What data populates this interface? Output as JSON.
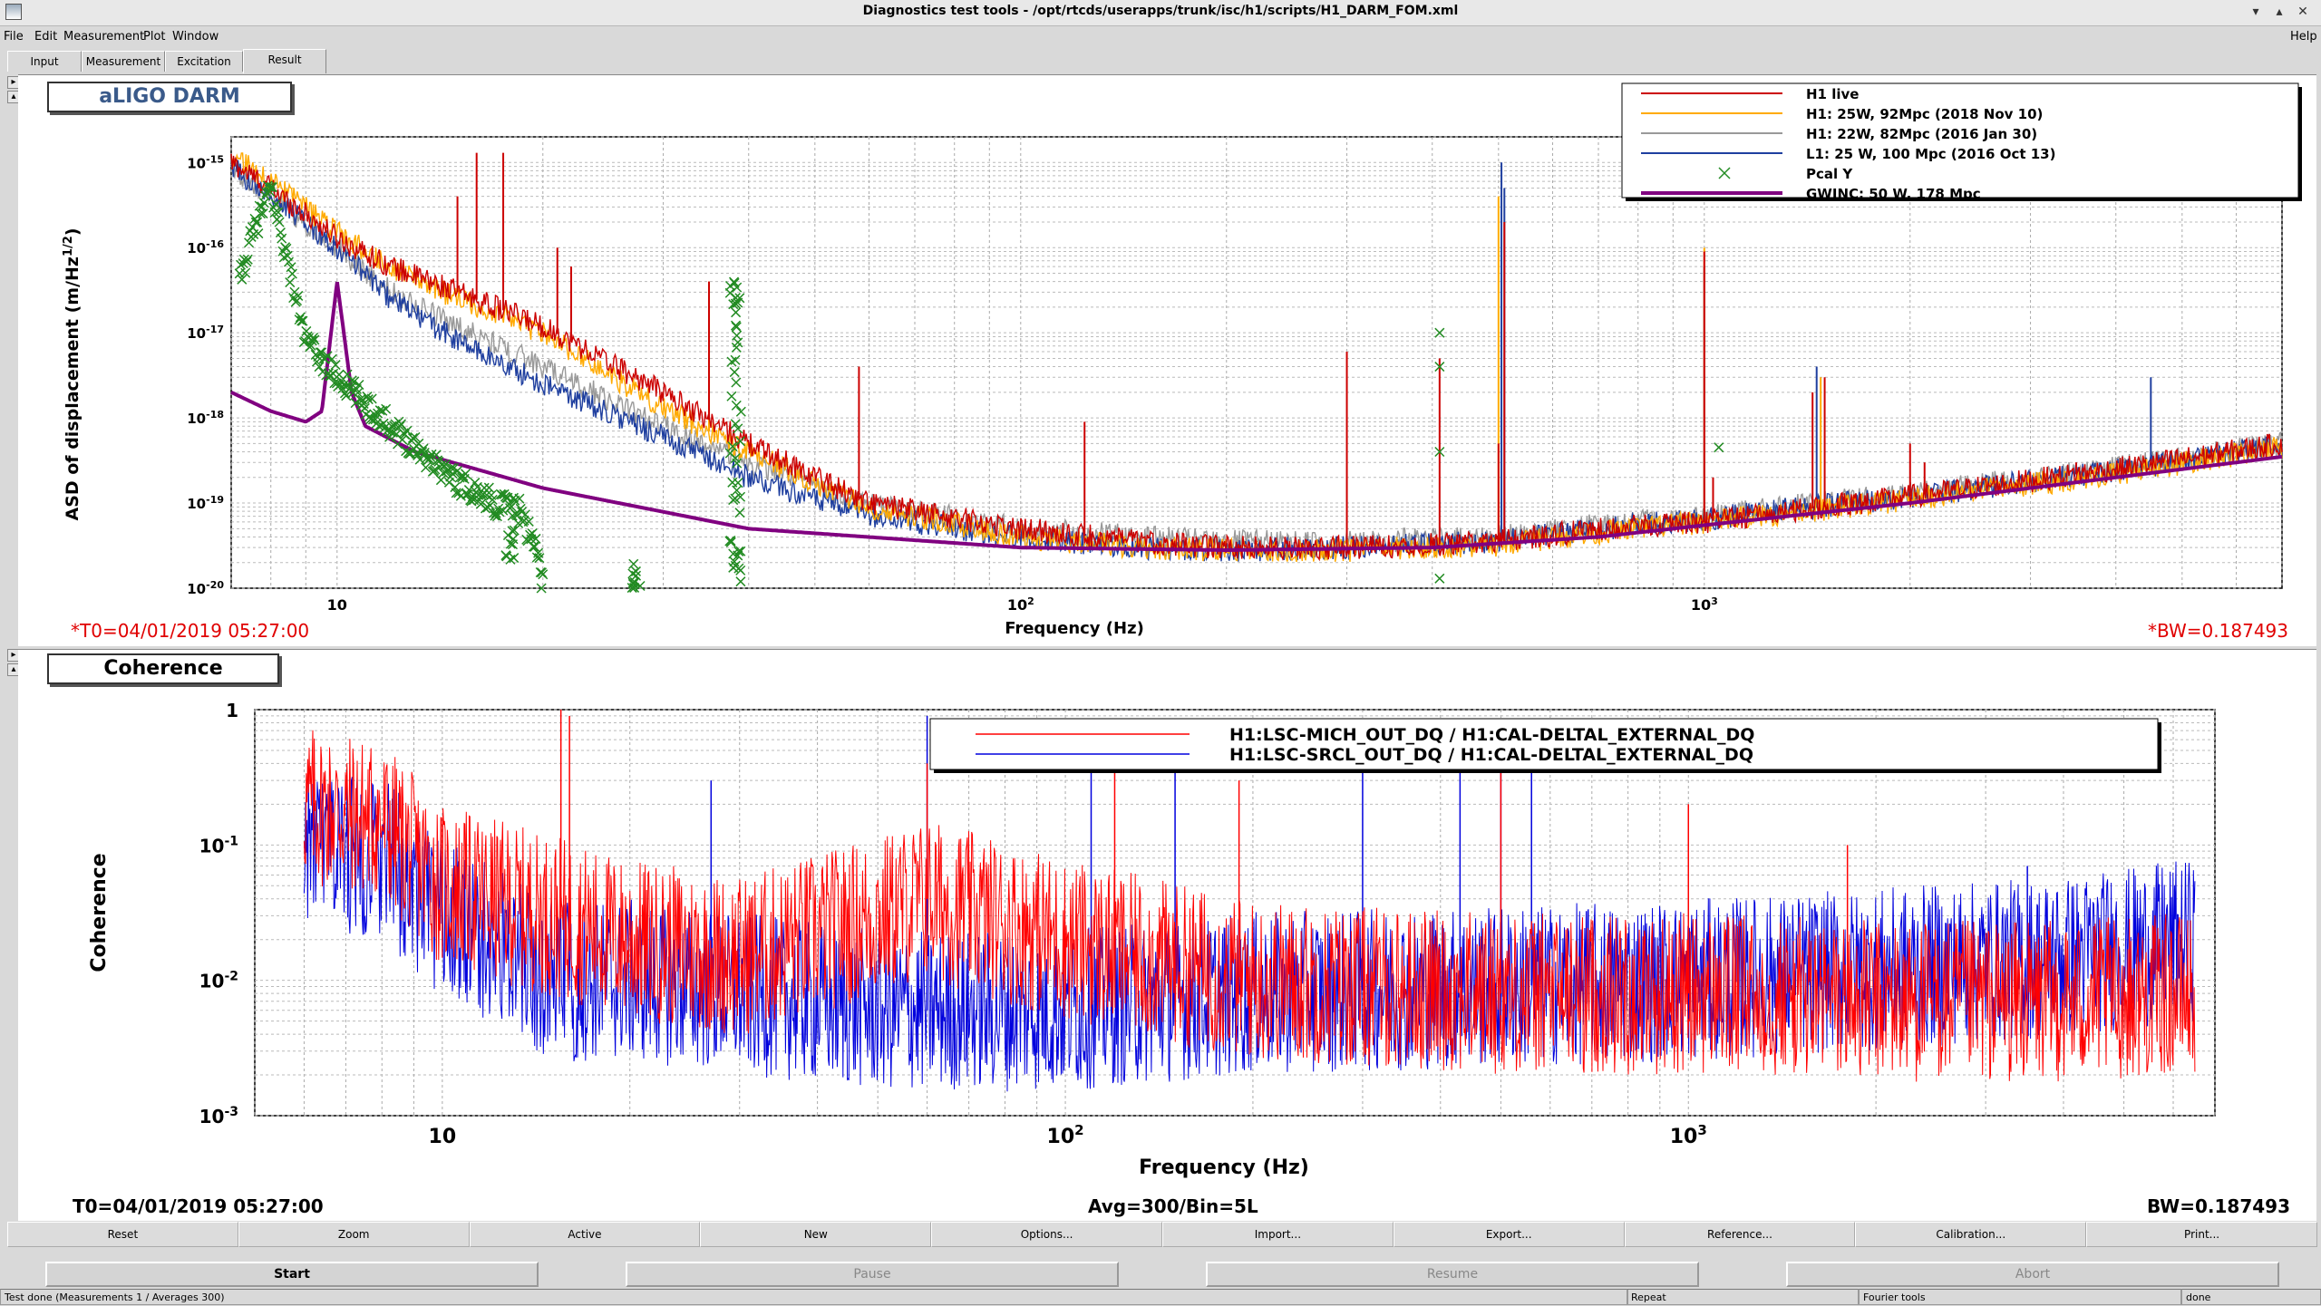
{
  "window": {
    "title": "Diagnostics test tools - /opt/rtcds/userapps/trunk/isc/h1/scripts/H1_DARM_FOM.xml"
  },
  "menu": {
    "file": "File",
    "edit": "Edit",
    "measurement": "Measurement",
    "plot": "Plot",
    "window": "Window",
    "help": "Help"
  },
  "tabs": [
    "Input",
    "Measurement",
    "Excitation",
    "Result"
  ],
  "top_plot": {
    "label": "aLIGO DARM",
    "t0": "*T0=04/01/2019 05:27:00",
    "bw": "*BW=0.187493"
  },
  "bottom_plot": {
    "label": "Coherence",
    "t0": "T0=04/01/2019 05:27:00",
    "avg": "Avg=300/Bin=5L",
    "bw": "BW=0.187493"
  },
  "chart_data": [
    {
      "type": "line",
      "title": "",
      "xlabel": "Frequency (Hz)",
      "ylabel": "ASD of displacement (m/Hz^1/2)",
      "xscale": "log",
      "yscale": "log",
      "xlim": [
        7,
        7000
      ],
      "ylim": [
        1e-20,
        2e-15
      ],
      "grid": true,
      "legend_position": "top-right",
      "x_tick_labels": [
        "10",
        "10^2",
        "10^3"
      ],
      "y_tick_labels": [
        "10^-15",
        "10^-16",
        "10^-17",
        "10^-18",
        "10^-19",
        "10^-20"
      ],
      "series": [
        {
          "name": "H1 live",
          "color": "#cc0000",
          "x": [
            7,
            8,
            10,
            12,
            15,
            20,
            30,
            40,
            60,
            100,
            150,
            200,
            300,
            500,
            700,
            1000,
            2000,
            4000,
            7000
          ],
          "y": [
            1e-15,
            5e-16,
            1.3e-16,
            6e-17,
            3e-17,
            1.2e-17,
            2e-18,
            5e-19,
            1e-19,
            5e-20,
            3.5e-20,
            3e-20,
            3e-20,
            3.5e-20,
            5e-20,
            6e-20,
            1.2e-19,
            2.5e-19,
            5e-19
          ]
        },
        {
          "name": "H1: 25W, 92Mpc (2018 Nov 10)",
          "color": "#ffaa00",
          "x": [
            7,
            8,
            10,
            12,
            15,
            20,
            30,
            40,
            60,
            100,
            150,
            200,
            300,
            500,
            700,
            1000,
            2000,
            4000,
            7000
          ],
          "y": [
            1.2e-15,
            6e-16,
            1.5e-16,
            6e-17,
            2.5e-17,
            1e-17,
            1.3e-18,
            4e-19,
            9e-20,
            4e-20,
            3e-20,
            2.8e-20,
            2.8e-20,
            3.2e-20,
            4.5e-20,
            6e-20,
            1.1e-19,
            2.2e-19,
            4.5e-19
          ]
        },
        {
          "name": "H1: 22W, 82Mpc (2016 Jan 30)",
          "color": "#999999",
          "x": [
            7,
            8,
            10,
            12,
            15,
            20,
            30,
            40,
            60,
            100,
            150,
            200,
            300,
            500,
            700,
            1000,
            2000,
            4000,
            7000
          ],
          "y": [
            8e-16,
            4e-16,
            1e-16,
            3e-17,
            1.2e-17,
            4e-18,
            8e-19,
            3e-19,
            1e-19,
            5e-20,
            4e-20,
            3.5e-20,
            3.5e-20,
            4e-20,
            5.5e-20,
            7e-20,
            1.3e-19,
            2.6e-19,
            5e-19
          ]
        },
        {
          "name": "L1: 25 W, 100 Mpc (2016 Oct 13)",
          "color": "#1f3f9f",
          "x": [
            7,
            8,
            10,
            12,
            15,
            20,
            30,
            40,
            60,
            100,
            150,
            200,
            300,
            500,
            700,
            1000,
            2000,
            4000,
            7000
          ],
          "y": [
            9e-16,
            4e-16,
            1e-16,
            2.5e-17,
            8e-18,
            2.5e-18,
            6e-19,
            2e-19,
            7e-20,
            4e-20,
            3e-20,
            2.8e-20,
            3e-20,
            3.5e-20,
            5e-20,
            6.5e-20,
            1.2e-19,
            2.4e-19,
            4.8e-19
          ]
        },
        {
          "name": "Pcal Y",
          "color": "#228b22",
          "x": [
            7.2,
            7.5,
            8,
            9,
            10,
            12,
            15,
            17,
            18.5,
            19.9,
            27,
            38,
            410,
            410,
            410,
            1050
          ],
          "y": [
            4e-17,
            1.3e-16,
            5e-16,
            8e-18,
            3e-18,
            8e-19,
            1.8e-19,
            1e-19,
            8e-20,
            2e-20,
            1e-20,
            4e-17,
            1e-17,
            4e-19,
            1.3e-20,
            4.5e-19
          ]
        },
        {
          "name": "GWINC: 50 W, 178 Mpc",
          "color": "#800080",
          "x": [
            7,
            8,
            9,
            9.5,
            10,
            10.5,
            11,
            13,
            20,
            40,
            100,
            200,
            400,
            700,
            1000,
            2000,
            4000,
            7000
          ],
          "y": [
            2e-18,
            1.2e-18,
            9e-19,
            1.2e-18,
            4e-17,
            2e-18,
            8e-19,
            4e-19,
            1.5e-19,
            5e-20,
            3e-20,
            2.8e-20,
            3e-20,
            4e-20,
            5.5e-20,
            1e-19,
            2e-19,
            3.5e-19
          ]
        }
      ]
    },
    {
      "type": "line",
      "title": "",
      "xlabel": "Frequency (Hz)",
      "ylabel": "Coherence",
      "xscale": "log",
      "yscale": "log",
      "xlim": [
        5,
        7000
      ],
      "ylim": [
        0.001,
        1
      ],
      "grid": true,
      "legend_position": "top-center",
      "y_tick_labels": [
        "1",
        "10^-1",
        "10^-2",
        "10^-3"
      ],
      "x_tick_labels": [
        "10",
        "10^2",
        "10^3"
      ],
      "series": [
        {
          "name": "H1:LSC-MICH_OUT_DQ / H1:CAL-DELTAL_EXTERNAL_DQ",
          "color": "#ff0000",
          "x": [
            6,
            8,
            10,
            15,
            20,
            30,
            50,
            60,
            100,
            200,
            500,
            1000,
            2000,
            4000,
            6500
          ],
          "y": [
            0.2,
            0.15,
            0.05,
            0.03,
            0.02,
            0.015,
            0.03,
            0.04,
            0.02,
            0.01,
            0.008,
            0.008,
            0.007,
            0.007,
            0.008
          ]
        },
        {
          "name": "H1:LSC-SRCL_OUT_DQ / H1:CAL-DELTAL_EXTERNAL_DQ",
          "color": "#0000dd",
          "x": [
            6,
            8,
            10,
            15,
            20,
            30,
            50,
            60,
            100,
            200,
            500,
            1000,
            2000,
            4000,
            6500
          ],
          "y": [
            0.1,
            0.08,
            0.03,
            0.01,
            0.01,
            0.008,
            0.006,
            0.006,
            0.006,
            0.008,
            0.009,
            0.01,
            0.012,
            0.015,
            0.02
          ]
        }
      ]
    }
  ],
  "buttons": [
    "Reset",
    "Zoom",
    "Active",
    "New",
    "Options...",
    "Import...",
    "Export...",
    "Reference...",
    "Calibration...",
    "Print..."
  ],
  "controls": {
    "start": "Start",
    "pause": "Pause",
    "resume": "Resume",
    "abort": "Abort"
  },
  "status": {
    "main": "Test done (Measurements 1 / Averages 300)",
    "repeat": "Repeat",
    "fourier": "Fourier tools",
    "state": "done"
  }
}
